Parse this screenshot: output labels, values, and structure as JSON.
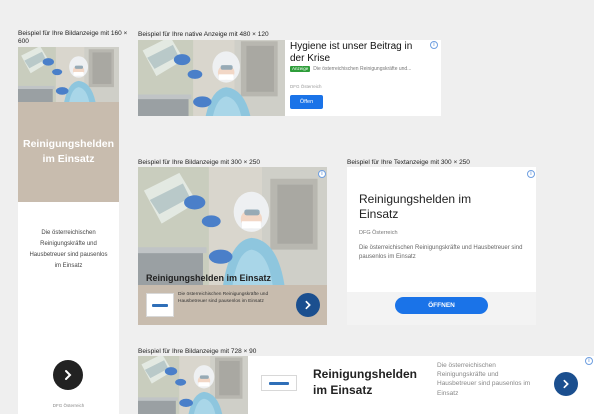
{
  "labels": {
    "ad160": "Beispiel für Ihre Bildanzeige mit 160 × 600",
    "native": "Beispiel für Ihre native Anzeige mit 480 × 120",
    "ad300img": "Beispiel für Ihre Bildanzeige mit 300 × 250",
    "ad300text": "Beispiel für Ihre Textanzeige mit 300 × 250",
    "ad728": "Beispiel für Ihre Bildanzeige mit 728 × 90"
  },
  "ad160": {
    "headline": "Reinigungshelden im Einsatz",
    "description": "Die österreichischen Reinigungskräfte und Hausbetreuer sind pausenlos im Einsatz",
    "advertiser": "DFG Österreich",
    "button_icon": "chevron-right-icon"
  },
  "native": {
    "headline": "Hygiene ist unser Beitrag in der Krise",
    "badge": "Anzeige",
    "description": "Die österreichischen Reinigungskräfte und...",
    "advertiser": "DFG Österreich",
    "button": "Öffen"
  },
  "ad300img": {
    "headline": "Reinigungshelden im Einsatz",
    "description": "Die österreichischen Reinigungskräfte und Hausbetreuer sind pausenlos im Einsatz",
    "button_icon": "chevron-right-icon"
  },
  "ad300text": {
    "headline": "Reinigungshelden im Einsatz",
    "advertiser": "DFG Österreich",
    "description": "Die österreichischen Reinigungskräfte und Hausbetreuer sind pausenlos im Einsatz",
    "button": "ÖFFNEN"
  },
  "ad728": {
    "headline": "Reinigungshelden im Einsatz",
    "description": "Die österreichischen Reinigungskräfte und Hausbetreuer sind pausenlos im Einsatz",
    "button_icon": "chevron-right-icon"
  },
  "colors": {
    "accent_blue": "#1a73e8",
    "dark_blue": "#1b4f8f",
    "banner_tan": "#c8bcae",
    "badge_green": "#2e9d3a",
    "text_gray": "#777777",
    "circle_dark": "#222222"
  }
}
